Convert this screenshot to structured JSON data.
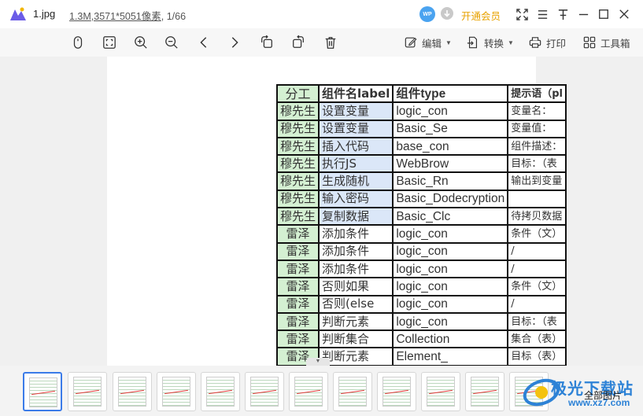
{
  "titlebar": {
    "file_name": "1.jpg",
    "file_size": "1.3M",
    "dimensions": ",3571*5051像素",
    "page_index": ", 1/66",
    "wp_badge": "WP",
    "vip_label": "开通会员"
  },
  "toolbar": {
    "edit_label": "编辑",
    "convert_label": "转换",
    "print_label": "打印",
    "toolbox_label": "工具箱"
  },
  "sheet": {
    "headers": [
      "分工",
      "组件名label",
      "组件type",
      "提示语（pl"
    ],
    "rows": [
      [
        "穆先生",
        "设置变量",
        "logic_con",
        "变量名："
      ],
      [
        "穆先生",
        "设置变量",
        "Basic_Se",
        "变量值："
      ],
      [
        "穆先生",
        "插入代码",
        "base_con",
        "组件描述："
      ],
      [
        "穆先生",
        "执行JS",
        "WebBrow",
        "目标：（表"
      ],
      [
        "穆先生",
        "生成随机",
        "Basic_Rn",
        "输出到变量"
      ],
      [
        "穆先生",
        "输入密码",
        "Basic_Dodecryption",
        ""
      ],
      [
        "穆先生",
        "复制数据",
        "Basic_Clc",
        "待拷贝数据"
      ],
      [
        "雷泽",
        "添加条件",
        "logic_con",
        "条件（文）"
      ],
      [
        "雷泽",
        "添加条件",
        "logic_con",
        "/"
      ],
      [
        "雷泽",
        "添加条件",
        "logic_con",
        "/"
      ],
      [
        "雷泽",
        "否则如果",
        "logic_con",
        "条件（文）"
      ],
      [
        "雷泽",
        "否则(else",
        "logic_con",
        "/"
      ],
      [
        "雷泽",
        "判断元素",
        "logic_con",
        "目标：（表"
      ],
      [
        "雷泽",
        "判断集合",
        "Collection",
        "集合（表）"
      ],
      [
        "雷泽",
        "判断元素",
        "Element_",
        "目标（表）"
      ]
    ]
  },
  "strip": {
    "all_label": "全部图片",
    "watermark_text": "极光下载站",
    "watermark_url": "www.xz7.com"
  },
  "colors": {
    "accent": "#3b7be8",
    "vip": "#e8a200",
    "green_cell": "#d4f0d2",
    "blue_cell": "#dbe7f8"
  }
}
